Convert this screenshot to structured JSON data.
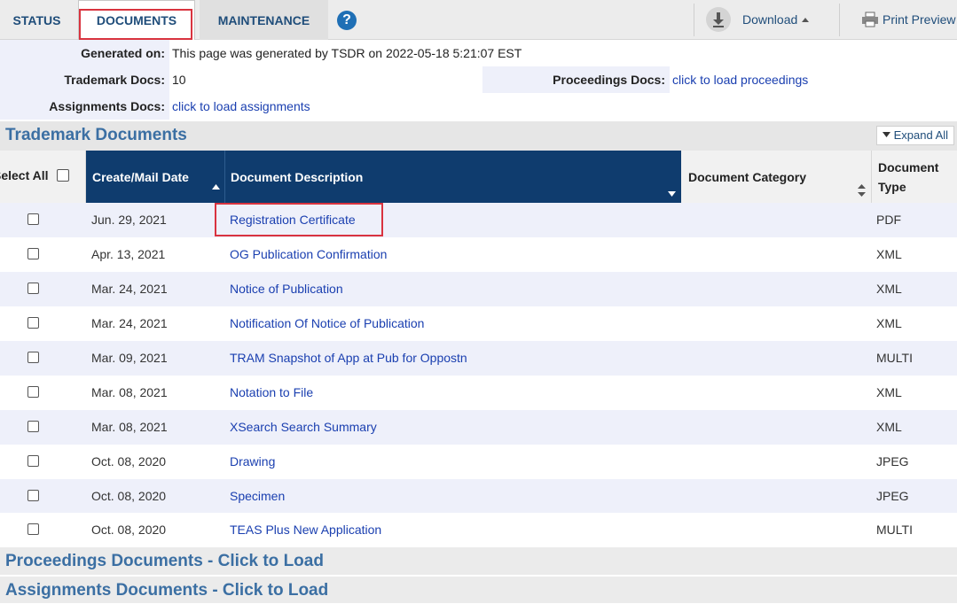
{
  "tabs": {
    "status": "STATUS",
    "documents": "DOCUMENTS",
    "maintenance": "MAINTENANCE",
    "help": "?"
  },
  "toolbar": {
    "download": "Download",
    "print": "Print Preview"
  },
  "info": {
    "generated_label": "Generated on:",
    "generated_value": "This page was generated by TSDR on 2022-05-18 5:21:07 EST",
    "tm_docs_label": "Trademark Docs:",
    "tm_docs_value": "10",
    "proc_docs_label": "Proceedings Docs:",
    "proc_docs_value": "click to load proceedings",
    "assign_docs_label": "Assignments Docs:",
    "assign_docs_value": "click to load assignments"
  },
  "section": {
    "title": "Trademark Documents",
    "expand_all": "Expand All"
  },
  "table": {
    "headers": {
      "select_all": "Select All",
      "date": "Create/Mail Date",
      "description": "Document Description",
      "category": "Document Category",
      "type": "Document Type"
    },
    "rows": [
      {
        "date": "Jun. 29, 2021",
        "description": "Registration Certificate",
        "category": "",
        "type": "PDF"
      },
      {
        "date": "Apr. 13, 2021",
        "description": "OG Publication Confirmation",
        "category": "",
        "type": "XML"
      },
      {
        "date": "Mar. 24, 2021",
        "description": "Notice of Publication",
        "category": "",
        "type": "XML"
      },
      {
        "date": "Mar. 24, 2021",
        "description": "Notification Of Notice of Publication",
        "category": "",
        "type": "XML"
      },
      {
        "date": "Mar. 09, 2021",
        "description": "TRAM Snapshot of App at Pub for Oppostn",
        "category": "",
        "type": "MULTI"
      },
      {
        "date": "Mar. 08, 2021",
        "description": "Notation to File",
        "category": "",
        "type": "XML"
      },
      {
        "date": "Mar. 08, 2021",
        "description": "XSearch Search Summary",
        "category": "",
        "type": "XML"
      },
      {
        "date": "Oct. 08, 2020",
        "description": "Drawing",
        "category": "",
        "type": "JPEG"
      },
      {
        "date": "Oct. 08, 2020",
        "description": "Specimen",
        "category": "",
        "type": "JPEG"
      },
      {
        "date": "Oct. 08, 2020",
        "description": "TEAS Plus New Application",
        "category": "",
        "type": "MULTI"
      }
    ]
  },
  "footer_sections": {
    "proceedings": "Proceedings Documents - Click to Load",
    "assignments": "Assignments Documents - Click to Load"
  },
  "colors": {
    "accent": "#0f3c6e",
    "link": "#1a3fb0",
    "highlight": "#d9333f",
    "stripe": "#eef0fa"
  }
}
